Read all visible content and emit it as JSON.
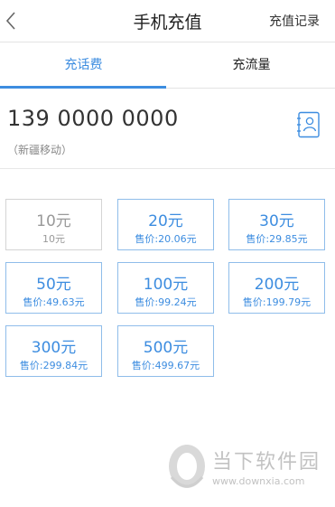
{
  "header": {
    "title": "手机充值",
    "history_label": "充值记录"
  },
  "tabs": [
    {
      "label": "充话费",
      "active": true
    },
    {
      "label": "充流量",
      "active": false
    }
  ],
  "phone": {
    "number": "139 0000 0000",
    "carrier": "（新疆移动）"
  },
  "options": [
    {
      "amount": "10元",
      "price": "10元",
      "enabled": false
    },
    {
      "amount": "20元",
      "price": "售价:20.06元",
      "enabled": true
    },
    {
      "amount": "30元",
      "price": "售价:29.85元",
      "enabled": true
    },
    {
      "amount": "50元",
      "price": "售价:49.63元",
      "enabled": true
    },
    {
      "amount": "100元",
      "price": "售价:99.24元",
      "enabled": true
    },
    {
      "amount": "200元",
      "price": "售价:199.79元",
      "enabled": true
    },
    {
      "amount": "300元",
      "price": "售价:299.84元",
      "enabled": true
    },
    {
      "amount": "500元",
      "price": "售价:499.67元",
      "enabled": true
    }
  ],
  "watermark": {
    "text": "当下软件园",
    "url": "www.downxia.com"
  },
  "colors": {
    "accent": "#3d8de0",
    "card_border": "#8fbdea",
    "disabled": "#999999",
    "divider": "#e3e3e3"
  }
}
